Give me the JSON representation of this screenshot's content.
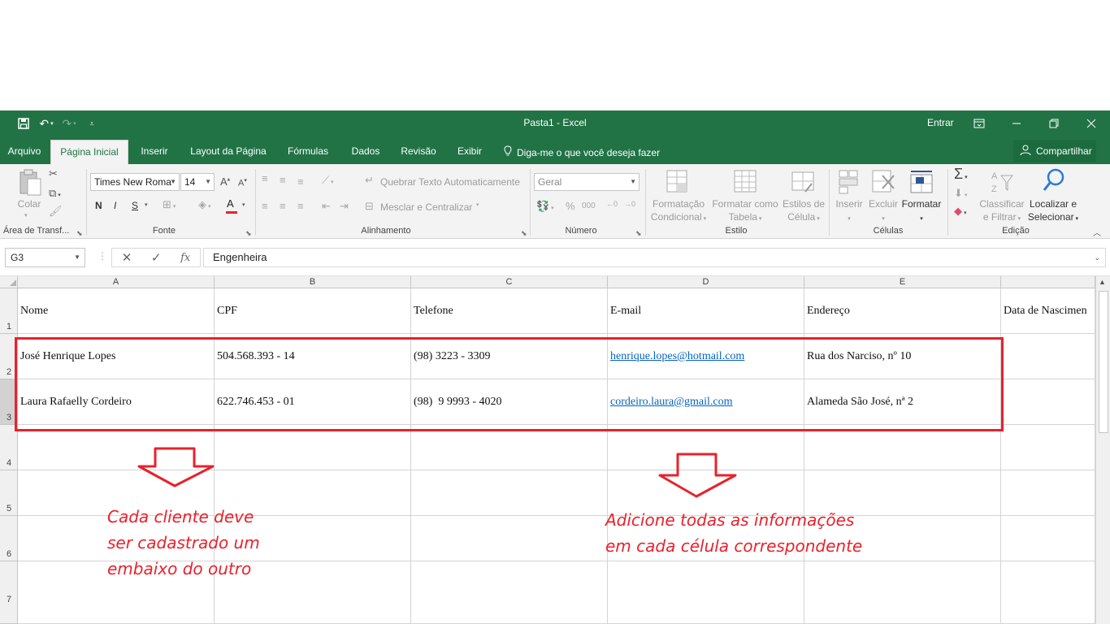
{
  "window": {
    "title": "Pasta1 - Excel",
    "signin": "Entrar",
    "qat": {
      "save_icon": "save-icon",
      "undo_icon": "undo-icon",
      "redo_icon": "redo-icon",
      "customize_icon": "customize-icon"
    }
  },
  "tabs": [
    {
      "label": "Arquivo",
      "active": false
    },
    {
      "label": "Página Inicial",
      "active": true
    },
    {
      "label": "Inserir",
      "active": false
    },
    {
      "label": "Layout da Página",
      "active": false
    },
    {
      "label": "Fórmulas",
      "active": false
    },
    {
      "label": "Dados",
      "active": false
    },
    {
      "label": "Revisão",
      "active": false
    },
    {
      "label": "Exibir",
      "active": false
    }
  ],
  "tellme": "Diga-me o que você deseja fazer",
  "share": "Compartilhar",
  "ribbon": {
    "clipboard": {
      "paste": "Colar",
      "label": "Área de Transf..."
    },
    "font": {
      "name": "Times New Roma",
      "size": "14",
      "bold": "N",
      "italic": "I",
      "underline": "S",
      "label": "Fonte"
    },
    "alignment": {
      "wrap": "Quebrar Texto Automaticamente",
      "merge": "Mesclar e Centralizar",
      "label": "Alinhamento"
    },
    "number": {
      "format": "Geral",
      "label": "Número"
    },
    "styles": {
      "conditional_1": "Formatação",
      "conditional_2": "Condicional",
      "table_1": "Formatar como",
      "table_2": "Tabela",
      "cell_1": "Estilos de",
      "cell_2": "Célula",
      "label": "Estilo"
    },
    "cells": {
      "insert": "Inserir",
      "delete": "Excluir",
      "format": "Formatar",
      "label": "Células"
    },
    "editing": {
      "sort_1": "Classificar",
      "sort_2": "e Filtrar",
      "find_1": "Localizar e",
      "find_2": "Selecionar",
      "label": "Edição"
    }
  },
  "formula_bar": {
    "namebox": "G3",
    "content": "Engenheira"
  },
  "columns": [
    "A",
    "B",
    "C",
    "D",
    "E"
  ],
  "rows": [
    "1",
    "2",
    "3",
    "4",
    "5",
    "6",
    "7"
  ],
  "sheet": {
    "r1": [
      "Nome",
      "CPF",
      "Telefone",
      "E-mail",
      "Endereço",
      "Data de Nascimen"
    ],
    "r2": [
      "José Henrique Lopes",
      "504.568.393 - 14",
      "(98) 3223 - 3309",
      "henrique.lopes@hotmail.com",
      "Rua dos Narciso, nº 10"
    ],
    "r3": [
      "Laura Rafaelly Cordeiro",
      "622.746.453 - 01",
      "(98)  9 9993 - 4020",
      "cordeiro.laura@gmail.com",
      "Alameda São José, nª 2"
    ]
  },
  "annotations": {
    "left": [
      "Cada cliente deve",
      "ser cadastrado um",
      "embaixo do outro"
    ],
    "right": [
      "Adicione todas as informações",
      "em cada célula correspondente"
    ],
    "color": "#e8222c"
  },
  "colors": {
    "excel_green": "#217346",
    "ribbon_bg": "#f3f3f3",
    "link": "#0563c1"
  }
}
